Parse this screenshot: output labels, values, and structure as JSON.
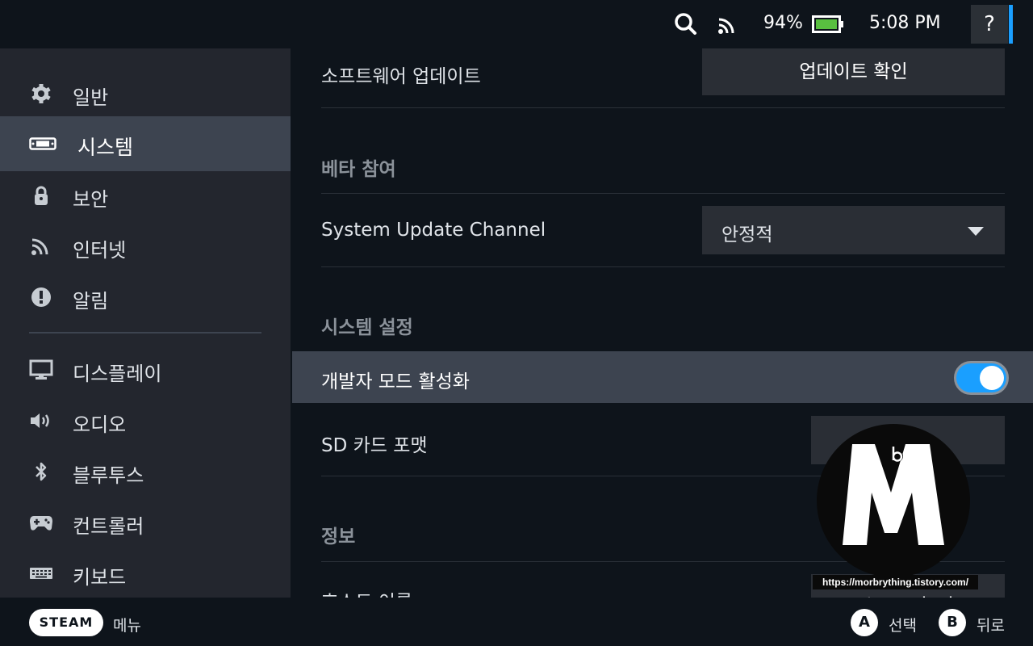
{
  "status_bar": {
    "battery_percent": "94%",
    "time": "5:08 PM",
    "help_label": "?"
  },
  "sidebar": {
    "items": [
      {
        "label": "일반",
        "icon": "gear-icon"
      },
      {
        "label": "시스템",
        "icon": "system-icon",
        "active": true
      },
      {
        "label": "보안",
        "icon": "lock-icon"
      },
      {
        "label": "인터넷",
        "icon": "wifi-icon"
      },
      {
        "label": "알림",
        "icon": "alert-icon"
      },
      {
        "label": "디스플레이",
        "icon": "monitor-icon"
      },
      {
        "label": "오디오",
        "icon": "speaker-icon"
      },
      {
        "label": "블루투스",
        "icon": "bluetooth-icon"
      },
      {
        "label": "컨트롤러",
        "icon": "gamepad-icon"
      },
      {
        "label": "키보드",
        "icon": "keyboard-icon"
      }
    ]
  },
  "main": {
    "software_update": {
      "label": "소프트웨어 업데이트",
      "button": "업데이트 확인"
    },
    "beta_section": "베타 참여",
    "update_channel": {
      "label": "System Update Channel",
      "value": "안정적"
    },
    "system_section": "시스템 설정",
    "developer_mode": {
      "label": "개발자 모드 활성화",
      "enabled": true
    },
    "sd_format": {
      "label": "SD 카드 포맷"
    },
    "info_section": "정보",
    "hostname": {
      "label": "호스트 이름",
      "value": "steamdeck"
    }
  },
  "watermark": {
    "url": "https://morbrything.tistory.com/"
  },
  "bottom_bar": {
    "steam_label": "STEAM",
    "menu_label": "메뉴",
    "a_button": "A",
    "a_label": "선택",
    "b_button": "B",
    "b_label": "뒤로"
  },
  "colors": {
    "accent": "#1a9fff",
    "battery": "#59bf40",
    "sidebar_bg": "#23262e",
    "highlight": "#3d4450"
  }
}
